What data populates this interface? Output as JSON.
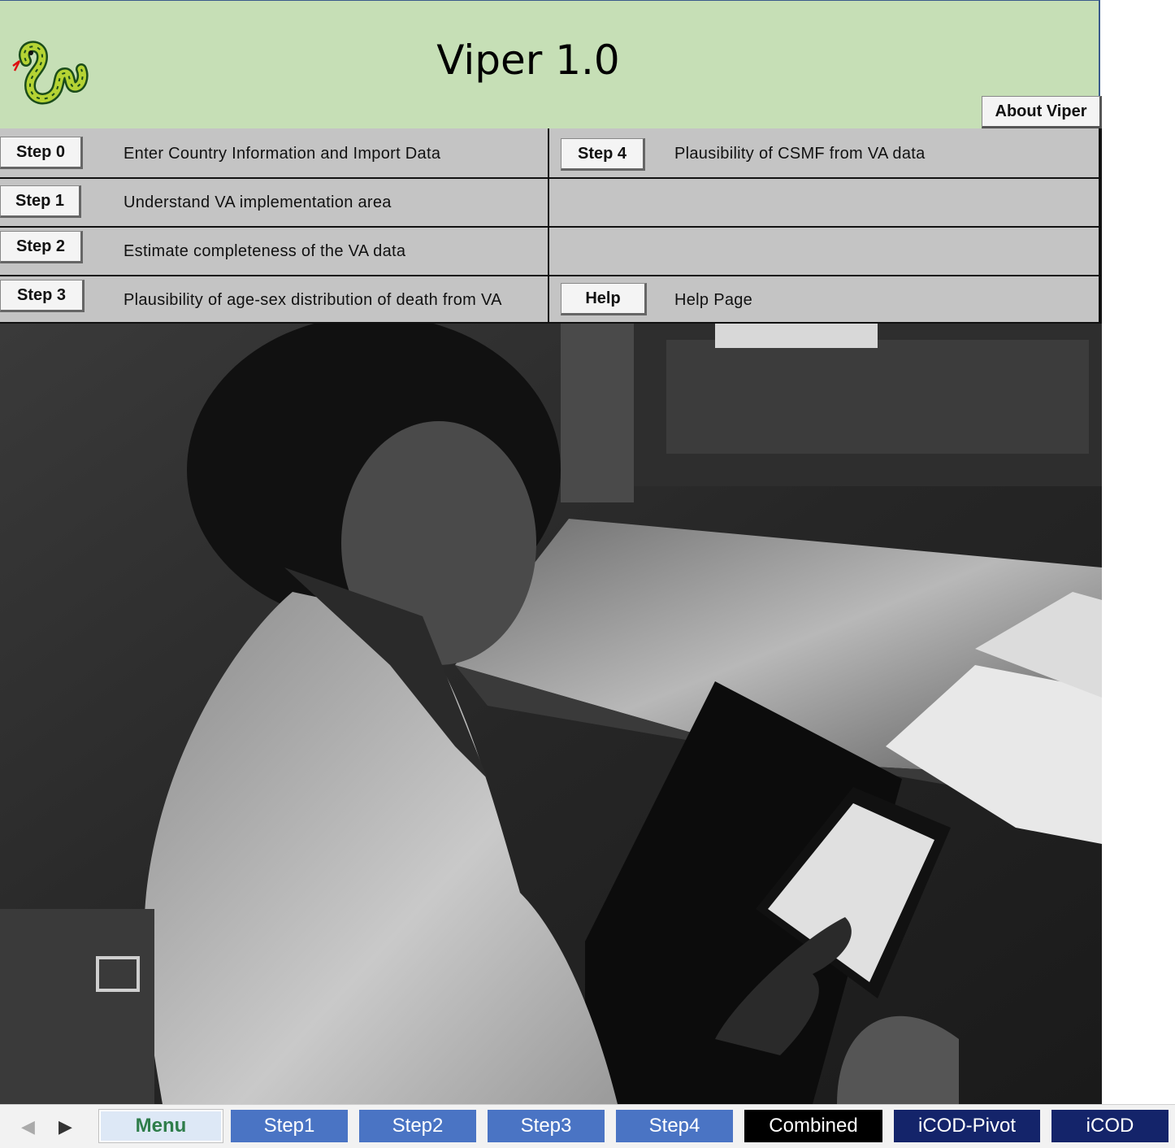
{
  "app": {
    "title": "Viper 1.0",
    "about_label": "About Viper"
  },
  "menu": {
    "left": [
      {
        "button": "Step 0",
        "description": "Enter Country Information and Import Data"
      },
      {
        "button": "Step 1",
        "description": "Understand VA implementation area"
      },
      {
        "button": "Step 2",
        "description": "Estimate completeness of the VA data"
      },
      {
        "button": "Step 3",
        "description": "Plausibility of age-sex distribution of death from VA"
      }
    ],
    "right": [
      {
        "button": "Step 4",
        "description": "Plausibility of CSMF from VA data"
      },
      {
        "button": "Help",
        "description": "Help Page"
      }
    ]
  },
  "sheet_tabs": {
    "tabs": [
      {
        "label": "Menu",
        "active": true,
        "color": "#dde8f6"
      },
      {
        "label": "Step1",
        "color": "#4a74c4"
      },
      {
        "label": "Step2",
        "color": "#4a74c4"
      },
      {
        "label": "Step3",
        "color": "#4a74c4"
      },
      {
        "label": "Step4",
        "color": "#4a74c4"
      },
      {
        "label": "Combined",
        "color": "#000000"
      },
      {
        "label": "iCOD-Pivot",
        "color": "#14246a"
      },
      {
        "label": "iCOD",
        "color": "#14246a"
      }
    ]
  },
  "colors": {
    "header_bg": "#c6dfb6",
    "menu_bg": "#c4c4c4",
    "tab_blue": "#4a74c4",
    "tab_navy": "#14246a"
  },
  "icons": {
    "logo": "snake-logo-icon",
    "prev": "triangle-left-icon",
    "next": "triangle-right-icon"
  }
}
